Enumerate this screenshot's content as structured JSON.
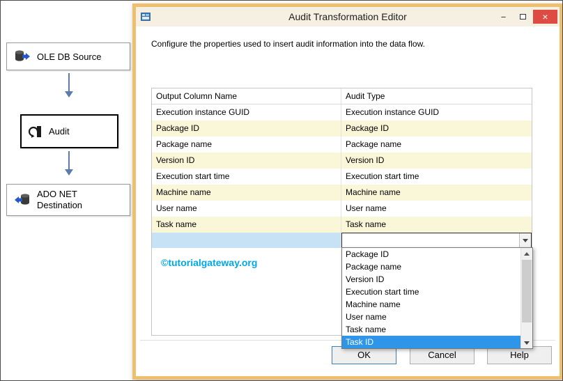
{
  "designer": {
    "nodes": [
      {
        "label": "OLE DB Source"
      },
      {
        "label": "Audit"
      },
      {
        "label": "ADO NET Destination"
      }
    ]
  },
  "dialog": {
    "title": "Audit Transformation Editor",
    "window_controls": {
      "minimize": "−",
      "close": "×"
    },
    "description": "Configure the properties used to insert audit information into the data flow.",
    "grid": {
      "columns": [
        "Output Column Name",
        "Audit Type"
      ],
      "rows": [
        {
          "name": "Execution instance GUID",
          "type": "Execution instance GUID"
        },
        {
          "name": "Package ID",
          "type": "Package ID"
        },
        {
          "name": "Package name",
          "type": "Package name"
        },
        {
          "name": "Version ID",
          "type": "Version ID"
        },
        {
          "name": "Execution start time",
          "type": "Execution start time"
        },
        {
          "name": "Machine name",
          "type": "Machine name"
        },
        {
          "name": "User name",
          "type": "User name"
        },
        {
          "name": "Task name",
          "type": "Task name"
        }
      ]
    },
    "dropdown": {
      "options": [
        "Package ID",
        "Package name",
        "Version ID",
        "Execution start time",
        "Machine name",
        "User name",
        "Task name",
        "Task ID"
      ],
      "selected": "Task ID"
    },
    "watermark": "©tutorialgateway.org",
    "buttons": {
      "ok": "OK",
      "cancel": "Cancel",
      "help": "Help"
    }
  },
  "colors": {
    "dialog_border": "#EDBF6F",
    "titlebar_bg": "#F5F0E1",
    "close_red": "#DD4B43",
    "row_alt": "#FAF6D8",
    "new_row_selection": "#C7E2F5",
    "dropdown_highlight": "#2E95E9",
    "watermark_color": "#00A8E4",
    "ok_border": "#3C7FB1",
    "connector": "#5B7CA8"
  }
}
